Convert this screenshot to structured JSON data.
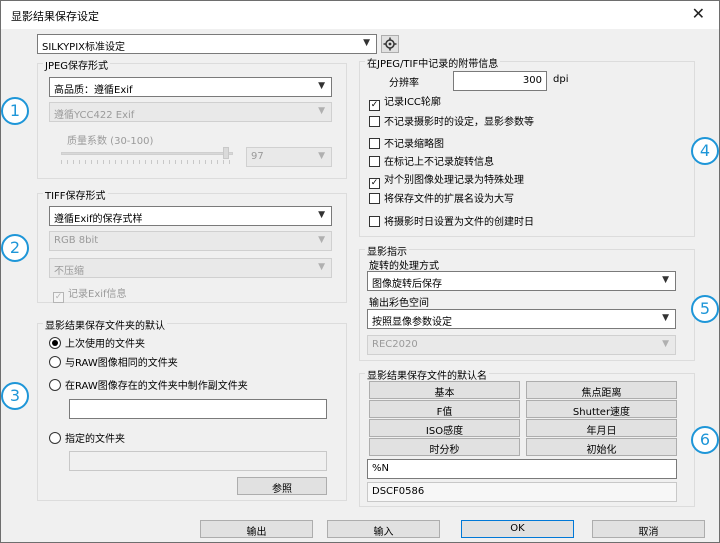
{
  "window": {
    "title": "显影结果保存设定",
    "close": "✕"
  },
  "preset": {
    "value": "SILKYPIX标准设定",
    "icon": "settings-gear-icon"
  },
  "jpeg": {
    "title": "JPEG保存形式",
    "quality_select": "高品质：遵循Exif",
    "color_select": "遵循YCC422 Exif",
    "quality_factor_label": "质量系数 (30-100)",
    "quality_value": "97",
    "quality_level_percent": 97
  },
  "tiff": {
    "title": "TIFF保存形式",
    "format_select": "遵循Exif的保存式样",
    "bit_select": "RGB 8bit",
    "compress_select": "不压缩",
    "exif_checkbox": "记录Exif信息",
    "exif_checked": true
  },
  "folder": {
    "title": "显影结果保存文件夹的默认",
    "options": [
      "上次使用的文件夹",
      "与RAW图像相同的文件夹",
      "在RAW图像存在的文件夹中制作副文件夹",
      "指定的文件夹"
    ],
    "selected_index": 0,
    "subfolder_value": "",
    "specified_value": "",
    "browse_button": "参照"
  },
  "embed": {
    "title": "在JPEG/TIF中记录的附带信息",
    "resolution_label": "分辨率",
    "resolution_value": "300",
    "resolution_unit": "dpi",
    "checks": [
      {
        "label": "记录ICC轮廓",
        "checked": true
      },
      {
        "label": "不记录摄影时的设定，显影参数等",
        "checked": false
      },
      {
        "label": "不记录缩略图",
        "checked": false
      },
      {
        "label": "在标记上不记录旋转信息",
        "checked": false
      },
      {
        "label": "对个别图像处理记录为特殊处理",
        "checked": true
      },
      {
        "label": "将保存文件的扩展名设为大写",
        "checked": false
      },
      {
        "label": "将摄影时日设置为文件的创建时日",
        "checked": false
      }
    ]
  },
  "develop": {
    "title": "显影指示",
    "rotation_label": "旋转的处理方式",
    "rotation_select": "图像旋转后保存",
    "colorspace_label": "输出彩色空间",
    "colorspace_select": "按照显像参数设定",
    "rec_select": "REC2020"
  },
  "filename": {
    "title": "显影结果保存文件的默认名",
    "buttons": [
      "基本",
      "焦点距离",
      "F值",
      "Shutter速度",
      "ISO感度",
      "年月日",
      "时分秒",
      "初始化"
    ],
    "pattern": "%N",
    "preview": "DSCF0586"
  },
  "footer": {
    "output": "输出",
    "import": "输入",
    "ok": "OK",
    "cancel": "取消"
  },
  "callouts": [
    "1",
    "2",
    "3",
    "4",
    "5",
    "6"
  ],
  "colors": {
    "callout": "#1e96d8",
    "focus": "#0078d7"
  }
}
